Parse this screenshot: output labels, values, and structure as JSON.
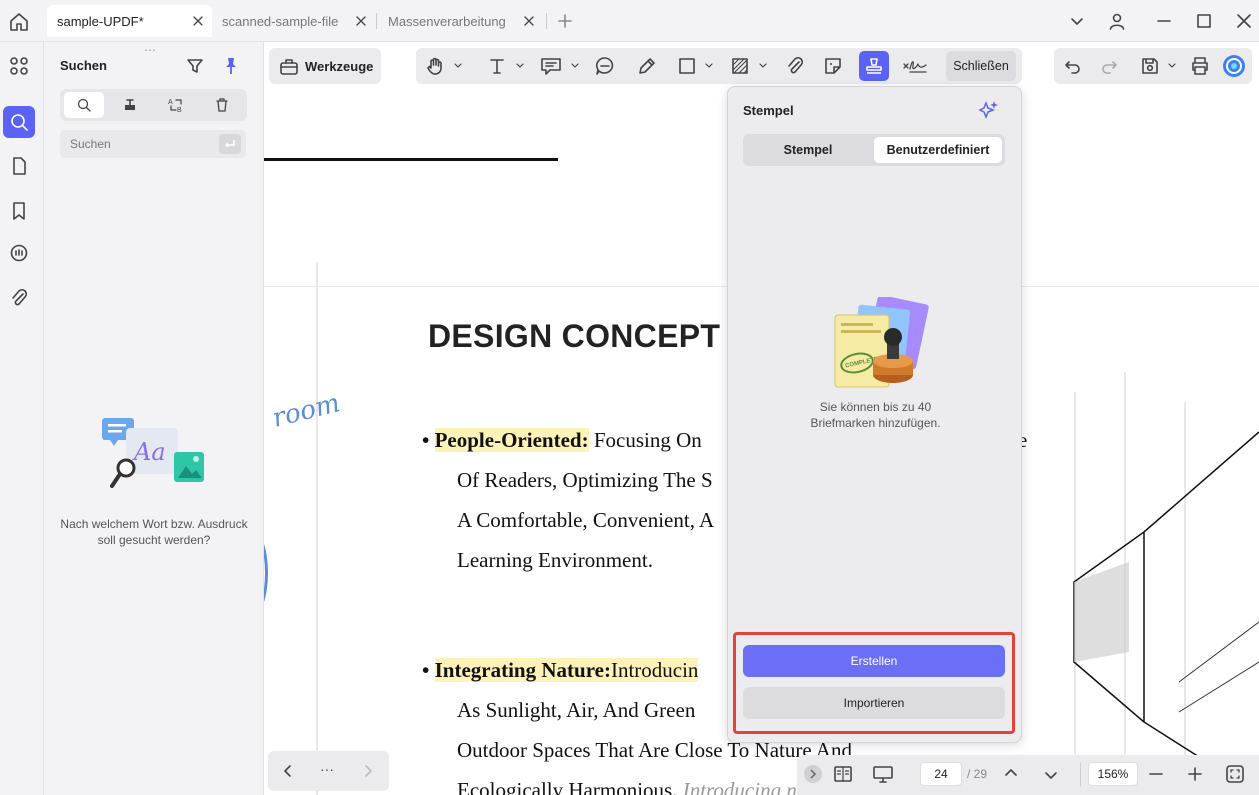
{
  "tabs": [
    {
      "label": "sample-UPDF*",
      "active": true
    },
    {
      "label": "scanned-sample-file",
      "active": false
    },
    {
      "label": "Massenverarbeitung",
      "active": false
    }
  ],
  "search_panel": {
    "title": "Suchen",
    "placeholder": "Suchen",
    "hint": "Nach welchem Wort bzw. Ausdruck soll gesucht werden?"
  },
  "toolbar": {
    "tools_label": "Werkzeuge",
    "close_label": "Schließen"
  },
  "document": {
    "heading": "DESIGN CONCEPT",
    "script_word": "room",
    "bullet1": {
      "term": "People-Oriented:",
      "line1": "Focusing On",
      "line1_tail": "e",
      "line2": "Of Readers, Optimizing The S",
      "line3": "A Comfortable, Convenient, A",
      "line4": "Learning Environment."
    },
    "bullet2": {
      "term": "Integrating Nature:",
      "line1": "Introducin",
      "line2": "As Sunlight, Air, And Green",
      "line3": "Outdoor Spaces That Are Close To Nature And",
      "line4": "Ecologically Harmonious.",
      "line4_tail": "Introducing natural elements"
    }
  },
  "stamp_panel": {
    "title": "Stempel",
    "tab_stamp": "Stempel",
    "tab_custom": "Benutzerdefiniert",
    "active_tab": "Benutzerdefiniert",
    "message": "Sie können bis zu 40 Briefmarken hinzufügen.",
    "stamp_text": "COMPLETED",
    "create_label": "Erstellen",
    "import_label": "Importieren"
  },
  "navigation": {
    "more_label": "···",
    "current_page": "24",
    "total_pages": "/ 29",
    "zoom": "156%"
  },
  "colors": {
    "accent": "#5b62f5",
    "highlight": "#fdf2b8",
    "selection_outline": "#e0443d"
  }
}
